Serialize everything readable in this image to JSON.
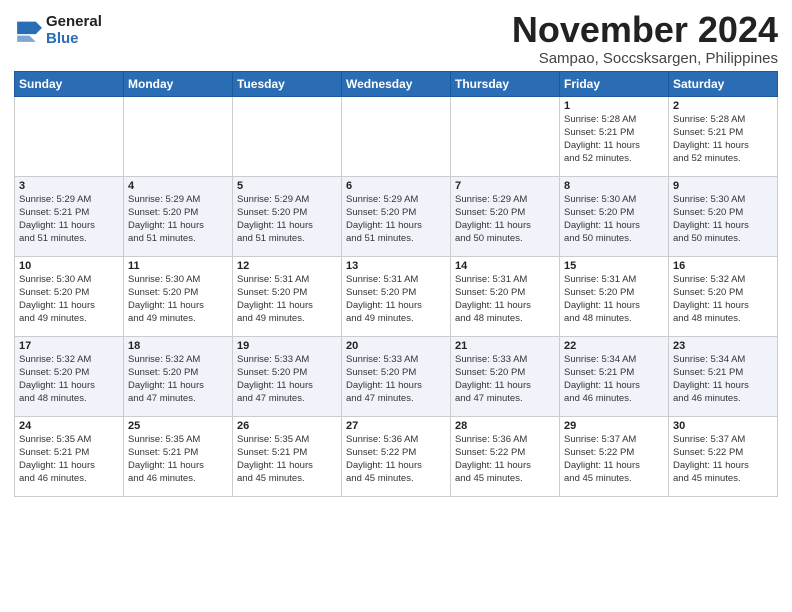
{
  "header": {
    "logo_general": "General",
    "logo_blue": "Blue",
    "month_title": "November 2024",
    "location": "Sampao, Soccsksargen, Philippines"
  },
  "days_of_week": [
    "Sunday",
    "Monday",
    "Tuesday",
    "Wednesday",
    "Thursday",
    "Friday",
    "Saturday"
  ],
  "weeks": [
    [
      {
        "day": "",
        "info": ""
      },
      {
        "day": "",
        "info": ""
      },
      {
        "day": "",
        "info": ""
      },
      {
        "day": "",
        "info": ""
      },
      {
        "day": "",
        "info": ""
      },
      {
        "day": "1",
        "info": "Sunrise: 5:28 AM\nSunset: 5:21 PM\nDaylight: 11 hours\nand 52 minutes."
      },
      {
        "day": "2",
        "info": "Sunrise: 5:28 AM\nSunset: 5:21 PM\nDaylight: 11 hours\nand 52 minutes."
      }
    ],
    [
      {
        "day": "3",
        "info": "Sunrise: 5:29 AM\nSunset: 5:21 PM\nDaylight: 11 hours\nand 51 minutes."
      },
      {
        "day": "4",
        "info": "Sunrise: 5:29 AM\nSunset: 5:20 PM\nDaylight: 11 hours\nand 51 minutes."
      },
      {
        "day": "5",
        "info": "Sunrise: 5:29 AM\nSunset: 5:20 PM\nDaylight: 11 hours\nand 51 minutes."
      },
      {
        "day": "6",
        "info": "Sunrise: 5:29 AM\nSunset: 5:20 PM\nDaylight: 11 hours\nand 51 minutes."
      },
      {
        "day": "7",
        "info": "Sunrise: 5:29 AM\nSunset: 5:20 PM\nDaylight: 11 hours\nand 50 minutes."
      },
      {
        "day": "8",
        "info": "Sunrise: 5:30 AM\nSunset: 5:20 PM\nDaylight: 11 hours\nand 50 minutes."
      },
      {
        "day": "9",
        "info": "Sunrise: 5:30 AM\nSunset: 5:20 PM\nDaylight: 11 hours\nand 50 minutes."
      }
    ],
    [
      {
        "day": "10",
        "info": "Sunrise: 5:30 AM\nSunset: 5:20 PM\nDaylight: 11 hours\nand 49 minutes."
      },
      {
        "day": "11",
        "info": "Sunrise: 5:30 AM\nSunset: 5:20 PM\nDaylight: 11 hours\nand 49 minutes."
      },
      {
        "day": "12",
        "info": "Sunrise: 5:31 AM\nSunset: 5:20 PM\nDaylight: 11 hours\nand 49 minutes."
      },
      {
        "day": "13",
        "info": "Sunrise: 5:31 AM\nSunset: 5:20 PM\nDaylight: 11 hours\nand 49 minutes."
      },
      {
        "day": "14",
        "info": "Sunrise: 5:31 AM\nSunset: 5:20 PM\nDaylight: 11 hours\nand 48 minutes."
      },
      {
        "day": "15",
        "info": "Sunrise: 5:31 AM\nSunset: 5:20 PM\nDaylight: 11 hours\nand 48 minutes."
      },
      {
        "day": "16",
        "info": "Sunrise: 5:32 AM\nSunset: 5:20 PM\nDaylight: 11 hours\nand 48 minutes."
      }
    ],
    [
      {
        "day": "17",
        "info": "Sunrise: 5:32 AM\nSunset: 5:20 PM\nDaylight: 11 hours\nand 48 minutes."
      },
      {
        "day": "18",
        "info": "Sunrise: 5:32 AM\nSunset: 5:20 PM\nDaylight: 11 hours\nand 47 minutes."
      },
      {
        "day": "19",
        "info": "Sunrise: 5:33 AM\nSunset: 5:20 PM\nDaylight: 11 hours\nand 47 minutes."
      },
      {
        "day": "20",
        "info": "Sunrise: 5:33 AM\nSunset: 5:20 PM\nDaylight: 11 hours\nand 47 minutes."
      },
      {
        "day": "21",
        "info": "Sunrise: 5:33 AM\nSunset: 5:20 PM\nDaylight: 11 hours\nand 47 minutes."
      },
      {
        "day": "22",
        "info": "Sunrise: 5:34 AM\nSunset: 5:21 PM\nDaylight: 11 hours\nand 46 minutes."
      },
      {
        "day": "23",
        "info": "Sunrise: 5:34 AM\nSunset: 5:21 PM\nDaylight: 11 hours\nand 46 minutes."
      }
    ],
    [
      {
        "day": "24",
        "info": "Sunrise: 5:35 AM\nSunset: 5:21 PM\nDaylight: 11 hours\nand 46 minutes."
      },
      {
        "day": "25",
        "info": "Sunrise: 5:35 AM\nSunset: 5:21 PM\nDaylight: 11 hours\nand 46 minutes."
      },
      {
        "day": "26",
        "info": "Sunrise: 5:35 AM\nSunset: 5:21 PM\nDaylight: 11 hours\nand 45 minutes."
      },
      {
        "day": "27",
        "info": "Sunrise: 5:36 AM\nSunset: 5:22 PM\nDaylight: 11 hours\nand 45 minutes."
      },
      {
        "day": "28",
        "info": "Sunrise: 5:36 AM\nSunset: 5:22 PM\nDaylight: 11 hours\nand 45 minutes."
      },
      {
        "day": "29",
        "info": "Sunrise: 5:37 AM\nSunset: 5:22 PM\nDaylight: 11 hours\nand 45 minutes."
      },
      {
        "day": "30",
        "info": "Sunrise: 5:37 AM\nSunset: 5:22 PM\nDaylight: 11 hours\nand 45 minutes."
      }
    ]
  ]
}
